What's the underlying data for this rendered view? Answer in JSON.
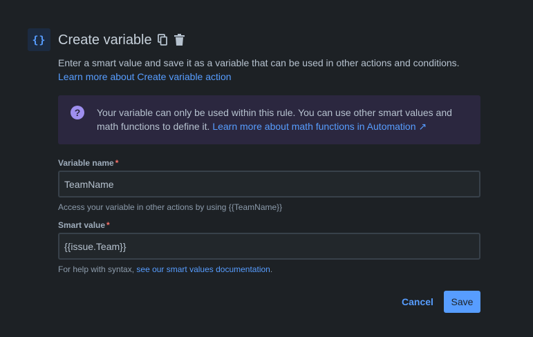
{
  "header": {
    "icon_glyph": "{}",
    "icon_name": "curly-braces-icon",
    "title": "Create variable",
    "copy_icon": "copy-icon",
    "delete_icon": "trash-icon"
  },
  "description": {
    "text": "Enter a smart value and save it as a variable that can be used in other actions and conditions. ",
    "link": "Learn more about Create variable action"
  },
  "info": {
    "icon_glyph": "?",
    "text": "Your variable can only be used within this rule. You can use other smart values and math functions to define it. ",
    "link": "Learn more about math functions in Automation ↗"
  },
  "variable_name": {
    "label": "Variable name",
    "required_marker": "*",
    "value": "TeamName",
    "helper": "Access your variable in other actions by using {{TeamName}}"
  },
  "smart_value": {
    "label": "Smart value",
    "required_marker": "*",
    "value": "{{issue.Team}}",
    "helper_text": "For help with syntax, ",
    "helper_link": "see our smart values documentation",
    "helper_suffix": "."
  },
  "actions": {
    "cancel_label": "Cancel",
    "save_label": "Save"
  },
  "colors": {
    "background": "#1d2125",
    "accent": "#579dff",
    "info_background": "#2b273f",
    "info_icon": "#9f8fef",
    "required": "#f87168"
  }
}
